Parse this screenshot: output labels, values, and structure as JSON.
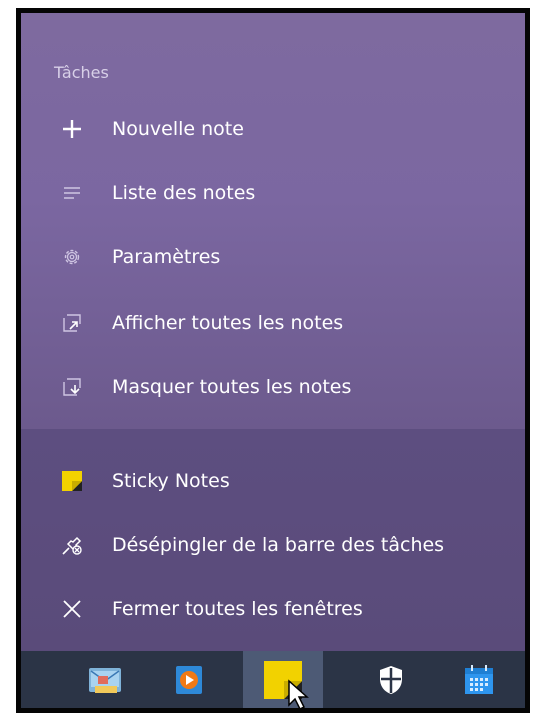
{
  "menu": {
    "tasks_title": "Tâches",
    "tasks": [
      {
        "label": "Nouvelle note",
        "icon": "plus-icon"
      },
      {
        "label": "Liste des notes",
        "icon": "list-icon"
      },
      {
        "label": "Paramètres",
        "icon": "gear-icon"
      },
      {
        "label": "Afficher toutes les notes",
        "icon": "show-notes-icon"
      },
      {
        "label": "Masquer toutes les notes",
        "icon": "hide-notes-icon"
      }
    ],
    "pinned": [
      {
        "label": "Sticky Notes",
        "icon": "sticky-notes-app-icon"
      },
      {
        "label": "Désépingler de la barre des tâches",
        "icon": "unpin-icon"
      },
      {
        "label": "Fermer toutes les fenêtres",
        "icon": "close-icon"
      }
    ]
  },
  "taskbar": {
    "apps": [
      {
        "name": "mail-app",
        "icon": "mail-icon"
      },
      {
        "name": "media-app",
        "icon": "media-player-icon"
      },
      {
        "name": "sticky-notes",
        "icon": "sticky-notes-icon",
        "active": true
      },
      {
        "name": "security",
        "icon": "shield-icon"
      },
      {
        "name": "calendar",
        "icon": "calendar-icon"
      }
    ]
  },
  "colors": {
    "menu_top": "#7b67a1",
    "menu_bottom": "#5a4b7a",
    "taskbar": "#2b3446",
    "sticky_yellow": "#f2d200"
  }
}
